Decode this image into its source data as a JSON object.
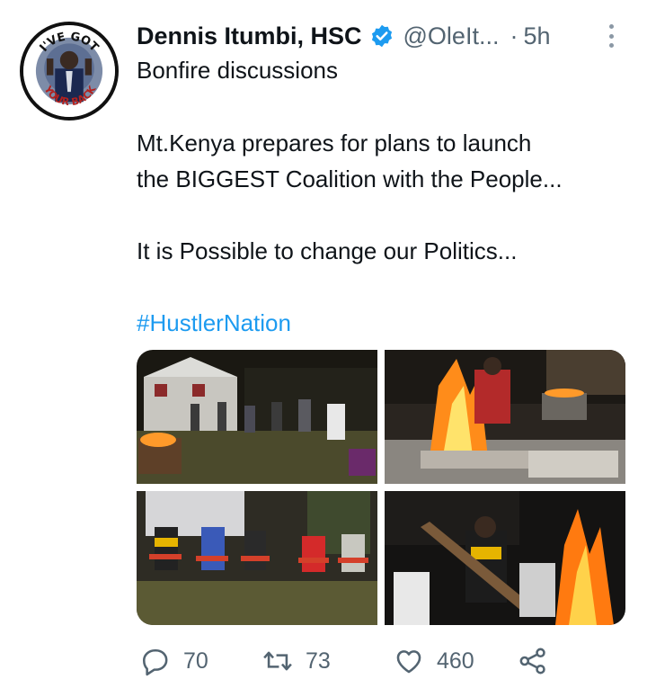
{
  "author": {
    "name": "Dennis Itumbi, HSC",
    "handle": "@OleIt...",
    "separator": "·",
    "time": "5h",
    "verified": true,
    "avatar_text_top": "I'VE GOT",
    "avatar_text_bottom": "YOUR BACK"
  },
  "tweet": {
    "line1": "Bonfire discussions",
    "line2": "Mt.Kenya prepares for plans to launch",
    "line3": "the BIGGEST Coalition with the People...",
    "line4": "It is Possible to change our Politics...",
    "hashtag": "#HustlerNation"
  },
  "photos": [
    {
      "name": "photo-tent-bonfire-circle"
    },
    {
      "name": "photo-man-at-fire-pit"
    },
    {
      "name": "photo-people-seated-chairs"
    },
    {
      "name": "photo-woman-with-log-fire"
    }
  ],
  "actions": {
    "replies": "70",
    "retweets": "73",
    "likes": "460"
  },
  "icons": {
    "verified": "verified-badge-icon",
    "more": "more-dots-icon",
    "reply": "reply-icon",
    "retweet": "retweet-icon",
    "like": "heart-icon",
    "share": "share-icon"
  },
  "colors": {
    "accent": "#1d9bf0",
    "text": "#0f1419",
    "secondary": "#536471"
  }
}
